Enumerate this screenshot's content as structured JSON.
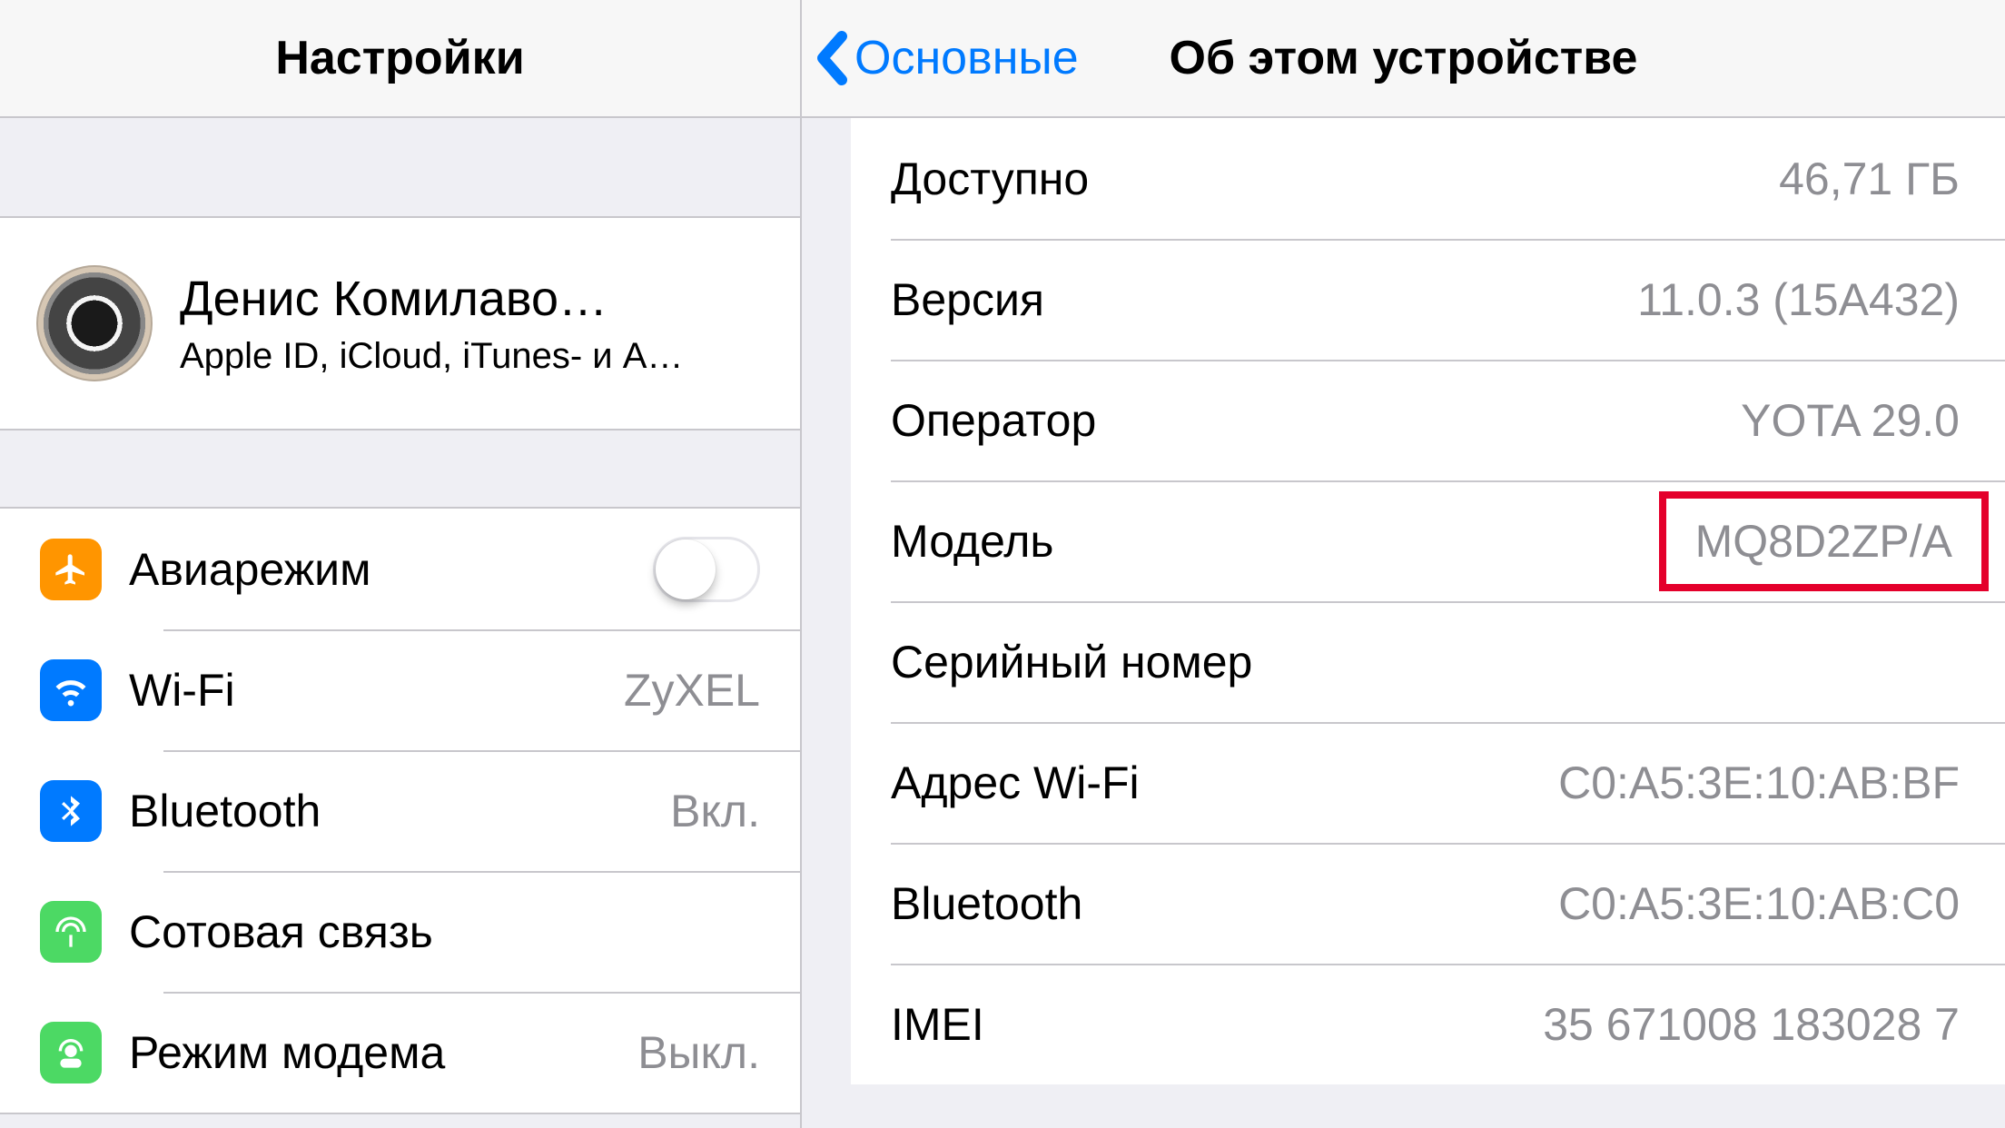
{
  "left": {
    "title": "Настройки",
    "profile": {
      "name": "Денис Комилаво…",
      "subtitle": "Apple ID, iCloud, iTunes- и A…"
    },
    "items": {
      "airplane": {
        "label": "Авиарежим",
        "switch_on": false
      },
      "wifi": {
        "label": "Wi-Fi",
        "value": "ZyXEL"
      },
      "bluetooth": {
        "label": "Bluetooth",
        "value": "Вкл."
      },
      "cellular": {
        "label": "Сотовая связь"
      },
      "hotspot": {
        "label": "Режим модема",
        "value": "Выкл."
      }
    }
  },
  "right": {
    "back_label": "Основные",
    "title": "Об этом устройстве",
    "rows": {
      "available": {
        "label": "Доступно",
        "value": "46,71 ГБ"
      },
      "version": {
        "label": "Версия",
        "value": "11.0.3 (15A432)"
      },
      "carrier": {
        "label": "Оператор",
        "value": "YOTA 29.0"
      },
      "model": {
        "label": "Модель",
        "value": "MQ8D2ZP/A",
        "highlighted": true
      },
      "serial": {
        "label": "Серийный номер",
        "value": ""
      },
      "wifi_addr": {
        "label": "Адрес Wi-Fi",
        "value": "C0:A5:3E:10:AB:BF"
      },
      "bt_addr": {
        "label": "Bluetooth",
        "value": "C0:A5:3E:10:AB:C0"
      },
      "imei": {
        "label": "IMEI",
        "value": "35 671008 183028 7"
      }
    }
  }
}
